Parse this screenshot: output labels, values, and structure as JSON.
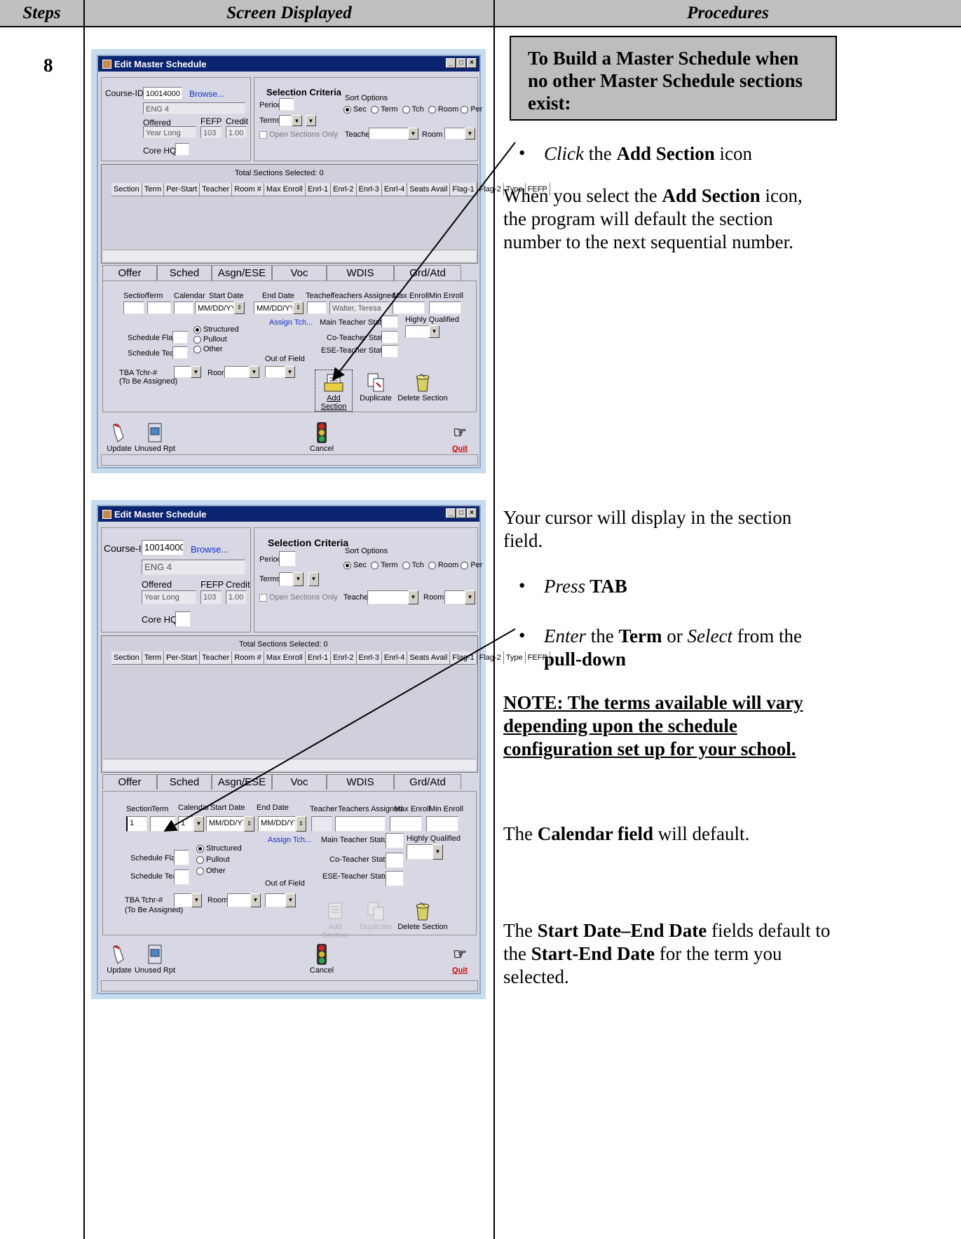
{
  "header": {
    "steps": "Steps",
    "screen": "Screen Displayed",
    "procedures": "Procedures"
  },
  "step_number": "8",
  "screenshot1": {
    "title": "Edit Master Schedule",
    "course_id_label": "Course-ID:",
    "course_id": "10014000",
    "browse": "Browse...",
    "course_name": "ENG 4",
    "offered_label": "Offered",
    "offered_value": "Year Long",
    "fefp_label": "FEFP",
    "fefp_value": "103",
    "credit_label": "Credit",
    "credit_value": "1.00",
    "core_hq_label": "Core HQ:",
    "selection_criteria": "Selection Criteria",
    "period_label": "Period",
    "terms_label": "Terms",
    "open_sections": "Open Sections Only",
    "sort_options": "Sort Options",
    "sort_sec": "Sec",
    "sort_term": "Term",
    "sort_tch": "Tch",
    "sort_room": "Room",
    "sort_per": "Per",
    "teacher_label": "Teacher",
    "room_label": "Room",
    "total_sections": "Total Sections Selected: 0",
    "grid_cols": [
      "Section",
      "Term",
      "Per-Start",
      "Teacher",
      "Room #",
      "Max Enroll",
      "Enrl-1",
      "Enrl-2",
      "Enrl-3",
      "Enrl-4",
      "Seats Avail",
      "Flag-1",
      "Flag-2",
      "Type",
      "FEFP"
    ],
    "tabs": [
      "Offer",
      "Sched",
      "Asgn/ESE",
      "Voc",
      "WDIS",
      "Grd/Atd"
    ],
    "section_label": "Section",
    "term_label": "Term",
    "calendar_label": "Calendar",
    "start_date_label": "Start Date",
    "end_date_label": "End Date",
    "date_placeholder": "MM/DD/YY",
    "teacher2_label": "Teacher",
    "teachers_assigned_label": "Teachers Assigned",
    "teachers_assigned_value": "Walter, Teresa",
    "max_enroll_label": "Max Enroll",
    "min_enroll_label": "Min Enroll",
    "assign_tch": "Assign Tch...",
    "main_teacher_status": "Main Teacher Status",
    "highly_qualified": "Highly Qualified",
    "schedule_flag": "Schedule Flag",
    "structured": "Structured",
    "pullout": "Pullout",
    "schedule_team": "Schedule Team",
    "other": "Other",
    "co_teacher_status": "Co-Teacher Status",
    "ese_teacher_status": "ESE-Teacher Status",
    "out_of_field": "Out of Field",
    "tba_tchr": "TBA Tchr-#",
    "to_be_assigned": "(To Be Assigned)",
    "room2_label": "Room",
    "add_section": "Add Section",
    "duplicate": "Duplicate",
    "delete_section": "Delete Section",
    "update": "Update",
    "unused_rpt": "Unused Rpt",
    "cancel": "Cancel",
    "quit": "Quit"
  },
  "screenshot2": {
    "title": "Edit Master Schedule",
    "section_value": "1",
    "calendar_value": "1",
    "teachers_assigned_value": ""
  },
  "procedures": {
    "callout": "To Build a Master Schedule when no other Master Schedule sections exist:",
    "b1_click": "Click",
    "b1_the": " the ",
    "b1_add": "Add Section",
    "b1_icon": " icon",
    "p1_a": "When you select the ",
    "p1_b": "Add Section",
    "p1_c": " icon, the program will default the section number to the next sequential number.",
    "p2": "Your cursor will display in the section field.",
    "b2_press": "Press",
    "b2_tab": " TAB",
    "b3_enter": "Enter",
    "b3_the": " the ",
    "b3_term": "Term",
    "b3_or": " or ",
    "b3_select": "Select",
    "b3_from": " from the ",
    "b3_pulldown": "pull-down",
    "note": "NOTE: The terms available will vary depending upon the schedule configuration set up for your school.",
    "p3_a": "The ",
    "p3_b": "Calendar field",
    "p3_c": " will default.",
    "p4_a": "The ",
    "p4_b": "Start Date–End Date",
    "p4_c": " fields default to the ",
    "p4_d": "Start-End Date",
    "p4_e": " for the term you selected."
  }
}
